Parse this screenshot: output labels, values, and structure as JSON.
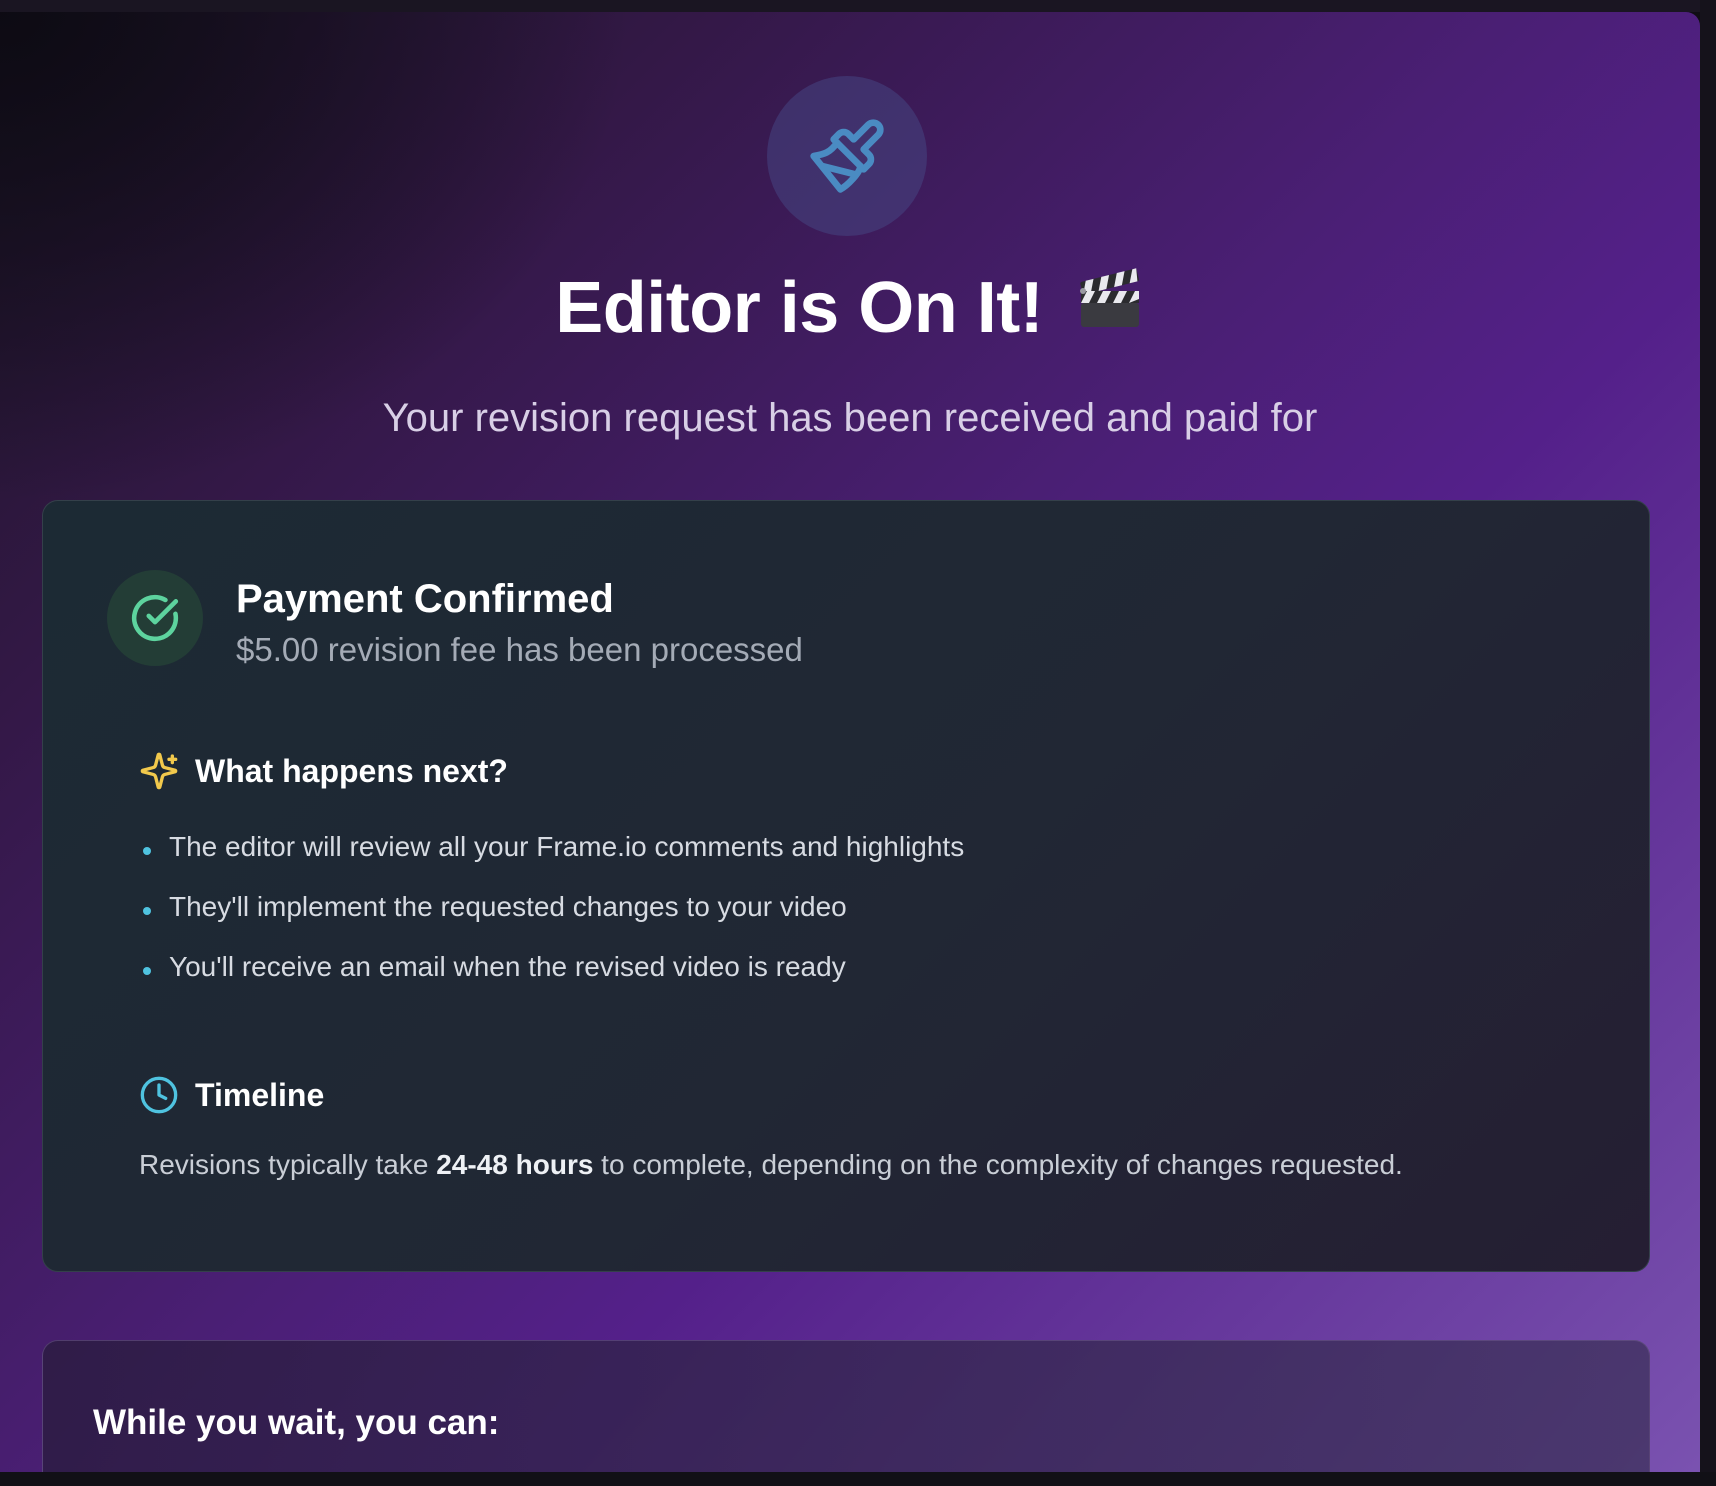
{
  "hero": {
    "title": "Editor is On It!",
    "subtitle": "Your revision request has been received and paid for",
    "icon": "paintbrush-icon",
    "emoji_icon": "clapperboard-icon"
  },
  "payment": {
    "title": "Payment Confirmed",
    "subtitle": "$5.00 revision fee has been processed",
    "icon": "check-circle-icon"
  },
  "next_steps": {
    "title": "What happens next?",
    "icon": "sparkles-icon",
    "items": [
      "The editor will review all your Frame.io comments and highlights",
      "They'll implement the requested changes to your video",
      "You'll receive an email when the revised video is ready"
    ]
  },
  "timeline": {
    "title": "Timeline",
    "icon": "clock-icon",
    "text_before": "Revisions typically take ",
    "text_bold": "24-48 hours",
    "text_after": " to complete, depending on the complexity of changes requested."
  },
  "wait_section": {
    "title": "While you wait, you can:"
  },
  "colors": {
    "accent_cyan": "#4fc3e0",
    "success_green": "#5dd39e",
    "sparkle_yellow": "#f2c94c",
    "background_purple": "#54208a"
  }
}
